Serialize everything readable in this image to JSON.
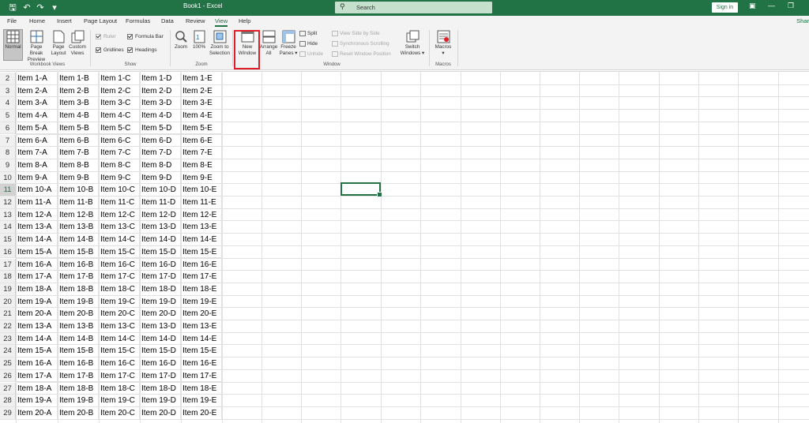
{
  "window": {
    "title": "Book1 - Excel",
    "search_placeholder": "Search",
    "sign_in": "Sign in"
  },
  "tabs": [
    "File",
    "Home",
    "Insert",
    "Page Layout",
    "Formulas",
    "Data",
    "Review",
    "View",
    "Help"
  ],
  "active_tab": "View",
  "share_label": "Shar",
  "ribbon": {
    "workbook_views": {
      "label": "Workbook Views",
      "normal": "Normal",
      "page_break_1": "Page Break",
      "page_break_2": "Preview",
      "page_layout_1": "Page",
      "page_layout_2": "Layout",
      "custom_1": "Custom",
      "custom_2": "Views"
    },
    "show": {
      "label": "Show",
      "ruler": "Ruler",
      "formula_bar": "Formula Bar",
      "gridlines": "Gridlines",
      "headings": "Headings"
    },
    "zoom": {
      "label": "Zoom",
      "zoom": "Zoom",
      "hundred": "100%",
      "zoom_sel_1": "Zoom to",
      "zoom_sel_2": "Selection"
    },
    "window": {
      "label": "Window",
      "new_window_1": "New",
      "new_window_2": "Window",
      "arrange_1": "Arrange",
      "arrange_2": "All",
      "freeze_1": "Freeze",
      "freeze_2": "Panes ▾",
      "split": "Split",
      "hide": "Hide",
      "unhide": "Unhide",
      "side_by_side": "View Side by Side",
      "sync_scroll": "Synchronous Scrolling",
      "reset_pos": "Reset Window Position",
      "switch_1": "Switch",
      "switch_2": "Windows ▾"
    },
    "macros": {
      "label": "Macros",
      "macros_1": "Macros",
      "macros_2": "▾"
    }
  },
  "sheet": {
    "row_numbers": [
      "2",
      "3",
      "4",
      "5",
      "6",
      "7",
      "8",
      "9",
      "10",
      "11",
      "12",
      "13",
      "14",
      "15",
      "16",
      "17",
      "18",
      "19",
      "20",
      "21",
      "22",
      "23",
      "24",
      "25",
      "26",
      "27",
      "28",
      "29"
    ],
    "selected_row": "11",
    "rows": [
      [
        "Item 1-A",
        "Item 1-B",
        "Item 1-C",
        "Item 1-D",
        "Item 1-E"
      ],
      [
        "Item 2-A",
        "Item 2-B",
        "Item 2-C",
        "Item 2-D",
        "Item 2-E"
      ],
      [
        "Item 3-A",
        "Item 3-B",
        "Item 3-C",
        "Item 3-D",
        "Item 3-E"
      ],
      [
        "Item 4-A",
        "Item 4-B",
        "Item 4-C",
        "Item 4-D",
        "Item 4-E"
      ],
      [
        "Item 5-A",
        "Item 5-B",
        "Item 5-C",
        "Item 5-D",
        "Item 5-E"
      ],
      [
        "Item 6-A",
        "Item 6-B",
        "Item 6-C",
        "Item 6-D",
        "Item 6-E"
      ],
      [
        "Item 7-A",
        "Item 7-B",
        "Item 7-C",
        "Item 7-D",
        "Item 7-E"
      ],
      [
        "Item 8-A",
        "Item 8-B",
        "Item 8-C",
        "Item 8-D",
        "Item 8-E"
      ],
      [
        "Item 9-A",
        "Item 9-B",
        "Item 9-C",
        "Item 9-D",
        "Item 9-E"
      ],
      [
        "Item 10-A",
        "Item 10-B",
        "Item 10-C",
        "Item 10-D",
        "Item 10-E"
      ],
      [
        "Item 11-A",
        "Item 11-B",
        "Item 11-C",
        "Item 11-D",
        "Item 11-E"
      ],
      [
        "Item 12-A",
        "Item 12-B",
        "Item 12-C",
        "Item 12-D",
        "Item 12-E"
      ],
      [
        "Item 13-A",
        "Item 13-B",
        "Item 13-C",
        "Item 13-D",
        "Item 13-E"
      ],
      [
        "Item 14-A",
        "Item 14-B",
        "Item 14-C",
        "Item 14-D",
        "Item 14-E"
      ],
      [
        "Item 15-A",
        "Item 15-B",
        "Item 15-C",
        "Item 15-D",
        "Item 15-E"
      ],
      [
        "Item 16-A",
        "Item 16-B",
        "Item 16-C",
        "Item 16-D",
        "Item 16-E"
      ],
      [
        "Item 17-A",
        "Item 17-B",
        "Item 17-C",
        "Item 17-D",
        "Item 17-E"
      ],
      [
        "Item 18-A",
        "Item 18-B",
        "Item 18-C",
        "Item 18-D",
        "Item 18-E"
      ],
      [
        "Item 19-A",
        "Item 19-B",
        "Item 19-C",
        "Item 19-D",
        "Item 19-E"
      ],
      [
        "Item 20-A",
        "Item 20-B",
        "Item 20-C",
        "Item 20-D",
        "Item 20-E"
      ],
      [
        "Item 13-A",
        "Item 13-B",
        "Item 13-C",
        "Item 13-D",
        "Item 13-E"
      ],
      [
        "Item 14-A",
        "Item 14-B",
        "Item 14-C",
        "Item 14-D",
        "Item 14-E"
      ],
      [
        "Item 15-A",
        "Item 15-B",
        "Item 15-C",
        "Item 15-D",
        "Item 15-E"
      ],
      [
        "Item 16-A",
        "Item 16-B",
        "Item 16-C",
        "Item 16-D",
        "Item 16-E"
      ],
      [
        "Item 17-A",
        "Item 17-B",
        "Item 17-C",
        "Item 17-D",
        "Item 17-E"
      ],
      [
        "Item 18-A",
        "Item 18-B",
        "Item 18-C",
        "Item 18-D",
        "Item 18-E"
      ],
      [
        "Item 19-A",
        "Item 19-B",
        "Item 19-C",
        "Item 19-D",
        "Item 19-E"
      ],
      [
        "Item 20-A",
        "Item 20-B",
        "Item 20-C",
        "Item 20-D",
        "Item 20-E"
      ]
    ]
  },
  "colors": {
    "accent": "#217346",
    "highlight": "#e01e27"
  }
}
